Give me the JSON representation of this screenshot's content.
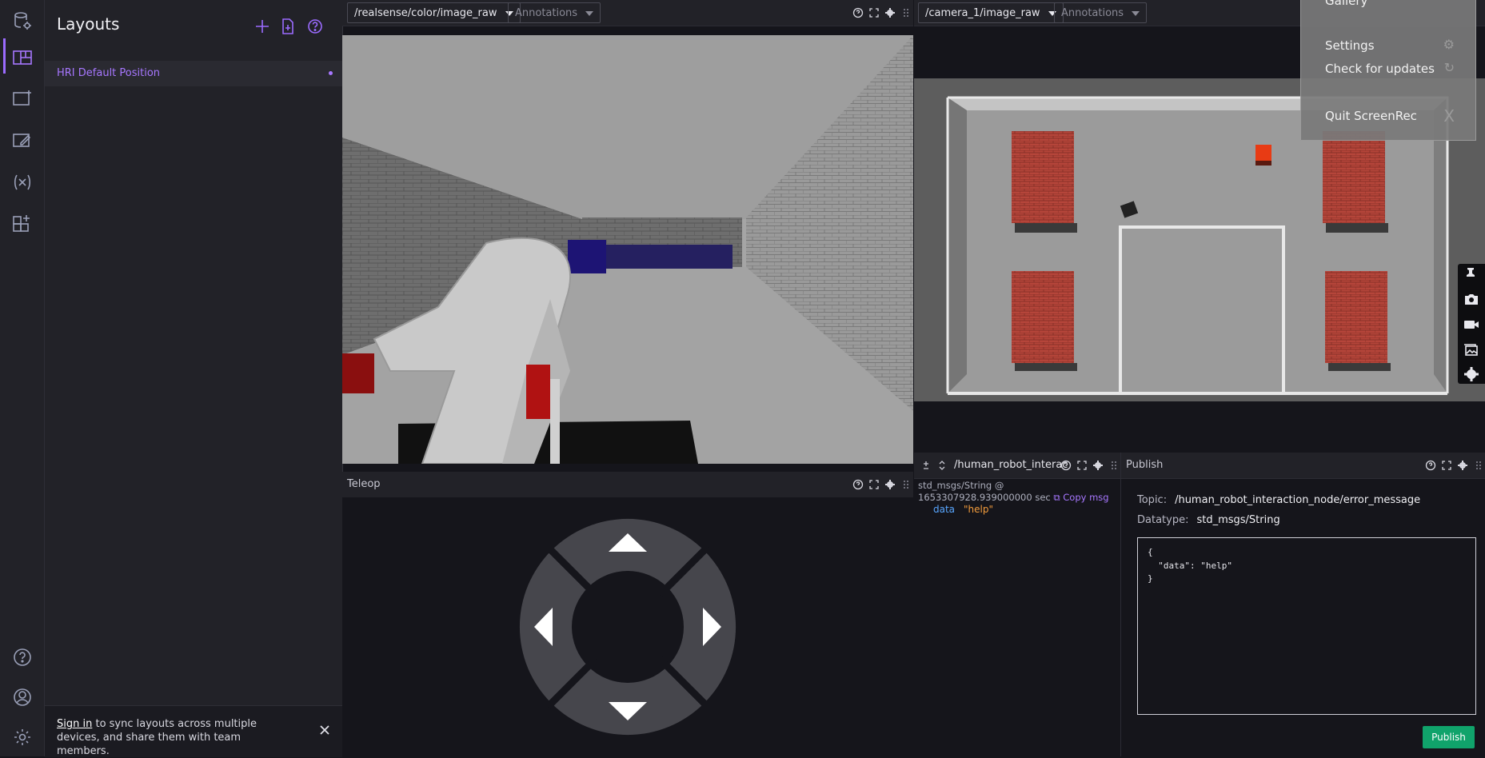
{
  "sidebar": {
    "title": "Layouts",
    "items": [
      {
        "label": "HRI Default Position"
      }
    ],
    "signin": {
      "link": "Sign in",
      "text": " to sync layouts across multiple devices, and share them with team members."
    }
  },
  "panels": {
    "image1": {
      "topic": "/realsense/color/image_raw",
      "annotations": "Annotations"
    },
    "image2": {
      "topic": "/camera_1/image_raw",
      "annotations": "Annotations"
    },
    "teleop": {
      "title": "Teleop"
    },
    "raw": {
      "topic": "/human_robot_interac",
      "meta": "std_msgs/String @ 1653307928.939000000 sec",
      "copy": "Copy msg",
      "field_key": "data",
      "field_value": "\"help\""
    },
    "publish": {
      "title": "Publish",
      "topic_label": "Topic:",
      "topic_value": "/human_robot_interaction_node/error_message",
      "datatype_label": "Datatype:",
      "datatype_value": "std_msgs/String",
      "editor": "{\n  \"data\": \"help\"\n}",
      "button": "Publish"
    }
  },
  "screenrec": {
    "items": [
      "Gallery",
      "Settings",
      "Check for updates",
      "Quit ScreenRec"
    ]
  }
}
